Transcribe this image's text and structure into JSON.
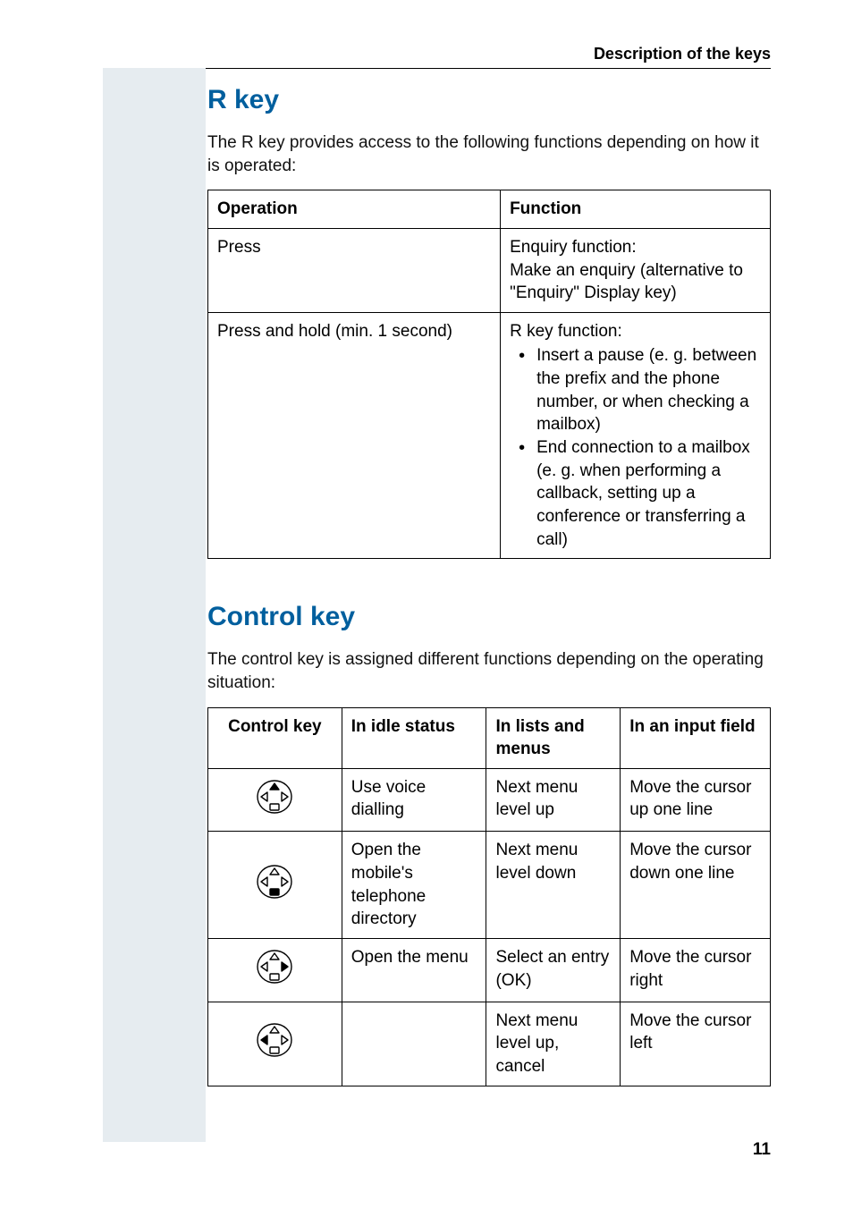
{
  "header": "Description of the keys",
  "page_number": "11",
  "section1": {
    "title": "R key",
    "intro": "The R key provides access to the following functions depending on how it is operated:",
    "headers": {
      "operation": "Operation",
      "function": "Function"
    },
    "rows": [
      {
        "operation": "Press",
        "function_lead": "Enquiry function:",
        "function_body": "Make an enquiry (alternative to \"Enquiry\" Display key)"
      },
      {
        "operation": "Press and hold (min. 1 second)",
        "function_lead": "R key function:",
        "bullets": [
          "Insert a pause (e. g. between the prefix and the phone number, or when checking a mailbox)",
          "End connection to a mailbox (e. g. when performing a callback, setting up a conference or transferring a call)"
        ]
      }
    ]
  },
  "section2": {
    "title": "Control key",
    "intro": "The control key is assigned different functions depending on the operating situation:",
    "headers": {
      "c1": "Control key",
      "c2": "In idle status",
      "c3": "In lists and menus",
      "c4": "In an input field"
    },
    "rows": [
      {
        "icon": "up",
        "idle": "Use voice dialling",
        "lists": "Next menu level up",
        "input": "Move the cursor up one line"
      },
      {
        "icon": "down",
        "idle": "Open the mobile's telephone directory",
        "lists": "Next menu level down",
        "input": "Move the cursor down one line"
      },
      {
        "icon": "right",
        "idle": "Open the menu",
        "lists": "Select an entry (OK)",
        "input": "Move the cursor right"
      },
      {
        "icon": "left",
        "idle": "",
        "lists": "Next menu level up, cancel",
        "input": "Move the cursor left"
      }
    ]
  }
}
